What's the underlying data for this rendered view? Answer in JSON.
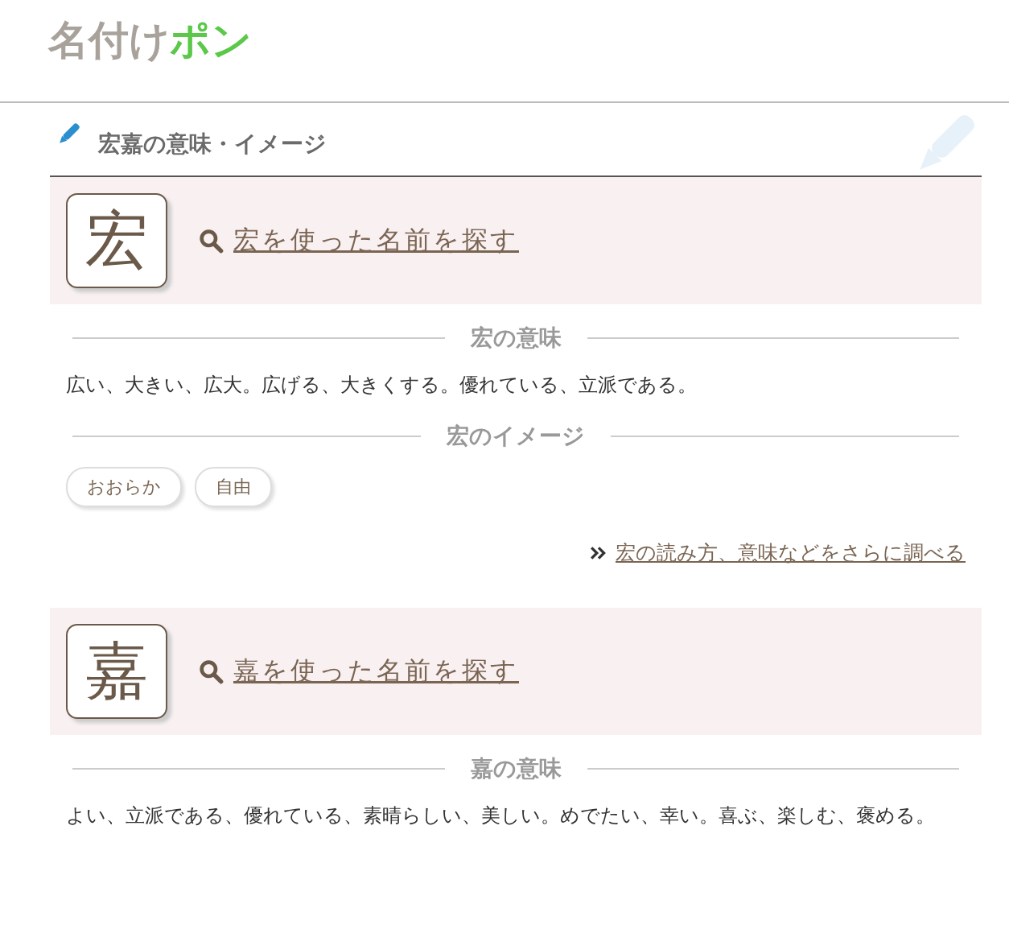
{
  "logo": {
    "main": "名付け",
    "accent": "ポン"
  },
  "section_title": "宏嘉の意味・イメージ",
  "kanji": [
    {
      "char": "宏",
      "search_link": "宏を使った名前を探す",
      "meaning_heading": "宏の意味",
      "meaning": "広い、大きい、広大。広げる、大きくする。優れている、立派である。",
      "image_heading": "宏のイメージ",
      "tags": [
        "おおらか",
        "自由"
      ],
      "more_link": "宏の読み方、意味などをさらに調べる"
    },
    {
      "char": "嘉",
      "search_link": "嘉を使った名前を探す",
      "meaning_heading": "嘉の意味",
      "meaning": "よい、立派である、優れている、素晴らしい、美しい。めでたい、幸い。喜ぶ、楽しむ、褒める。"
    }
  ]
}
